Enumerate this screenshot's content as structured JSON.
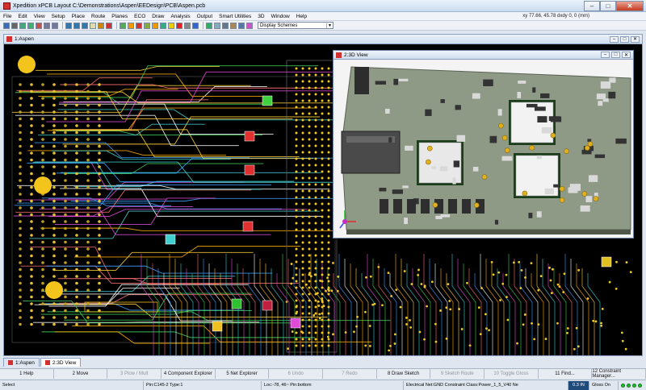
{
  "app": {
    "title": "Xpedition xPCB Layout  C:\\Demonstrations\\Aspen\\EEDesign\\PCB\\Aspen.pcb",
    "window_buttons": [
      "–",
      "□",
      "✕"
    ]
  },
  "menu": {
    "items": [
      "File",
      "Edit",
      "View",
      "Setup",
      "Place",
      "Route",
      "Planes",
      "ECO",
      "Draw",
      "Analysis",
      "Output",
      "Smart Utilities",
      "3D",
      "Window",
      "Help"
    ],
    "coords": "xy 77.66, 45.78  dxdy 0, 0  (mm)"
  },
  "toolbar": {
    "display_scheme": "Display Schemes"
  },
  "doc": {
    "title": "1:Aspen"
  },
  "view3d": {
    "title": "2:3D View"
  },
  "tabs": [
    "1:Aspen",
    "2:3D View"
  ],
  "fkeys": [
    {
      "label": "1 Help",
      "enabled": true
    },
    {
      "label": "2 Move",
      "enabled": true
    },
    {
      "label": "3 Plow / Mult",
      "enabled": false
    },
    {
      "label": "4 Component Explorer",
      "enabled": true
    },
    {
      "label": "5 Net Explorer",
      "enabled": true
    },
    {
      "label": "6 Undo",
      "enabled": false
    },
    {
      "label": "7 Redo",
      "enabled": false
    },
    {
      "label": "8 Draw Sketch",
      "enabled": true
    },
    {
      "label": "9 Sketch Route",
      "enabled": false
    },
    {
      "label": "10 Toggle Gloss",
      "enabled": false
    },
    {
      "label": "11 Find...",
      "enabled": true
    },
    {
      "label": "12 Constraint Manager...",
      "enabled": true
    }
  ],
  "status": {
    "mode": "Select",
    "pin": "Pin:C145-2 Type:1",
    "loc": "Loc:-78, 46~ Pin:bottom",
    "net": "Electrical Net:GND Constraint Class:Power_1_5_V40 Ne",
    "grid": "0.3 IN",
    "gloss": "Gloss On"
  },
  "colors": {
    "titlebar": "#c9dbef",
    "pcb_background": "#000000",
    "board_3d": "#8f9a86"
  }
}
